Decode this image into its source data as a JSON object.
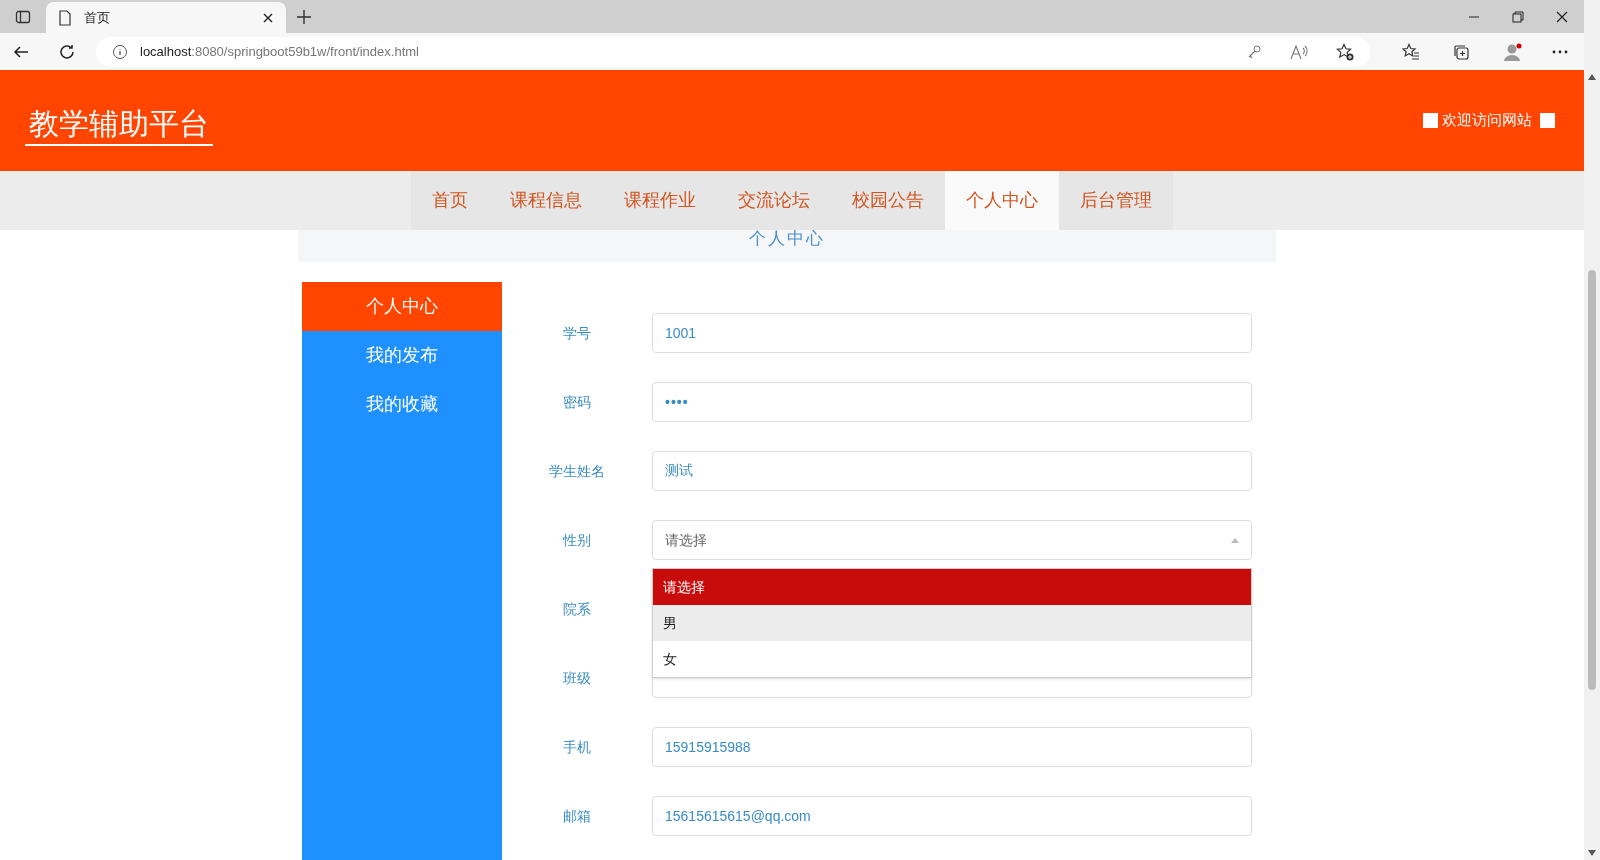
{
  "browser": {
    "tab_title": "首页",
    "url_host": "localhost",
    "url_path": ":8080/springboot59b1w/front/index.html"
  },
  "header": {
    "site_title": "教学辅助平台",
    "welcome": "欢迎访问网站"
  },
  "nav": [
    {
      "label": "首页",
      "selected": false
    },
    {
      "label": "课程信息",
      "selected": false
    },
    {
      "label": "课程作业",
      "selected": false
    },
    {
      "label": "交流论坛",
      "selected": false
    },
    {
      "label": "校园公告",
      "selected": false
    },
    {
      "label": "个人中心",
      "selected": true
    },
    {
      "label": "后台管理",
      "selected": false
    }
  ],
  "page_title": "个人中心",
  "sidebar": [
    {
      "label": "个人中心",
      "selected": true
    },
    {
      "label": "我的发布",
      "selected": false
    },
    {
      "label": "我的收藏",
      "selected": false
    }
  ],
  "form": [
    {
      "label": "学号",
      "kind": "text",
      "value": "1001"
    },
    {
      "label": "密码",
      "kind": "password",
      "value": "••••"
    },
    {
      "label": "学生姓名",
      "kind": "text",
      "value": "测试"
    },
    {
      "label": "性别",
      "kind": "select",
      "placeholder": "请选择",
      "expanded": true,
      "options": [
        {
          "label": "请选择",
          "selected": true,
          "hovered": false
        },
        {
          "label": "男",
          "selected": false,
          "hovered": true
        },
        {
          "label": "女",
          "selected": false,
          "hovered": false
        }
      ]
    },
    {
      "label": "院系",
      "kind": "text"
    },
    {
      "label": "班级",
      "kind": "text"
    },
    {
      "label": "手机",
      "kind": "text",
      "value": "15915915988"
    },
    {
      "label": "邮箱",
      "kind": "text",
      "value": "15615615615@qq.com"
    }
  ]
}
